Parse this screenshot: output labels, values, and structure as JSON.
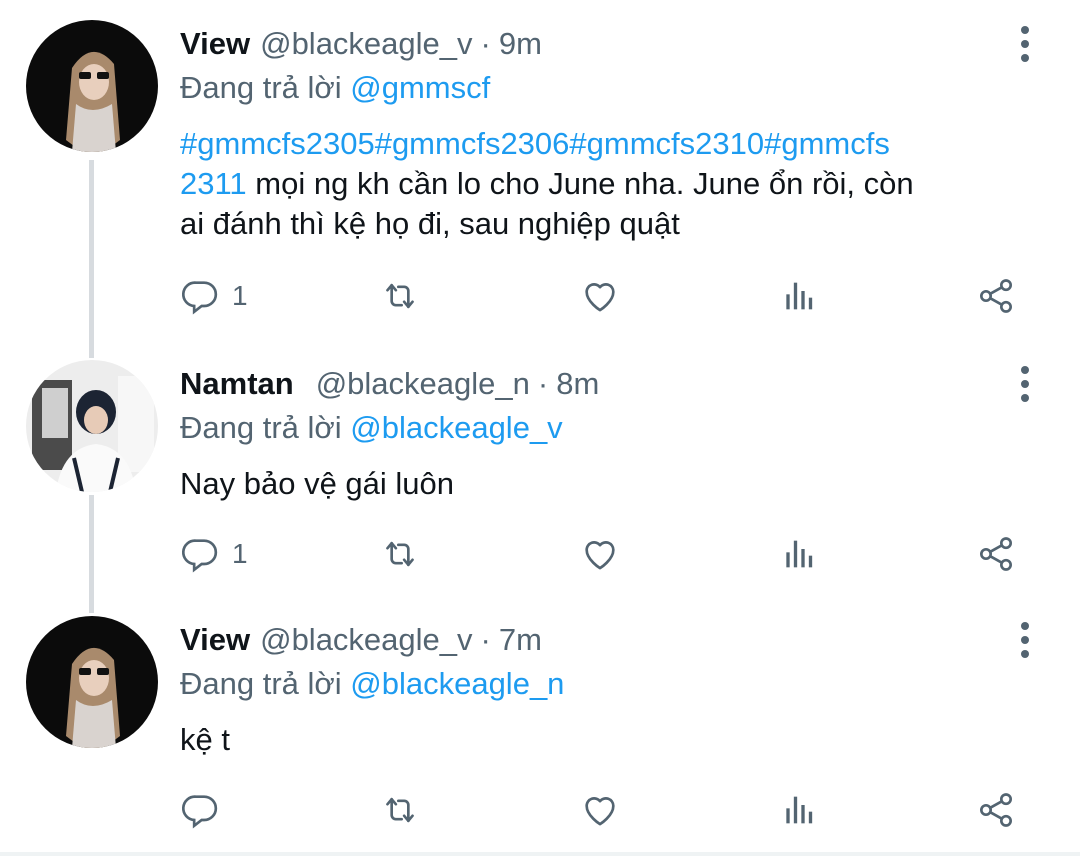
{
  "tweets": [
    {
      "name": "View",
      "handle": "@blackeagle_v",
      "time": "9m",
      "reply_prefix": "Đang trả lời",
      "reply_mention": "@gmmscf",
      "hashtags_line1": "#gmmcfs2305#gmmcfs2306#gmmcfs2310#gmmcfs",
      "hashtag_line2": "2311",
      "text_line2": " mọi ng kh cần lo cho June nha. June ổn rồi, còn",
      "text_line3": "ai đánh thì kệ họ đi, sau nghiệp quật",
      "reply_count": "1"
    },
    {
      "name": "Namtan",
      "handle": "@blackeagle_n",
      "time": "8m",
      "reply_prefix": "Đang trả lời",
      "reply_mention": "@blackeagle_v",
      "text": "Nay bảo vệ gái luôn",
      "reply_count": "1"
    },
    {
      "name": "View",
      "handle": "@blackeagle_v",
      "time": "7m",
      "reply_prefix": "Đang trả lời",
      "reply_mention": "@blackeagle_n",
      "text": "kệ t",
      "reply_count": ""
    }
  ],
  "separator": "·",
  "icons": [
    "reply-icon",
    "retweet-icon",
    "like-icon",
    "analytics-icon",
    "share-icon",
    "more-icon"
  ],
  "colors": {
    "link": "#1d9bf0",
    "secondary": "#536471",
    "text": "#0f1419",
    "thread_line": "#d7dbdf"
  }
}
